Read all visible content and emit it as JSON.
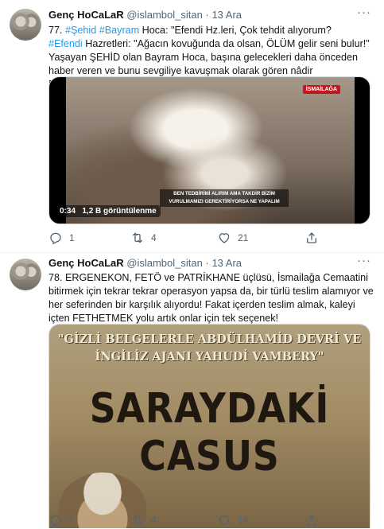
{
  "tweets": [
    {
      "author_name": "Genç HoCaLaR",
      "handle": "@islambol_sitan",
      "separator": "·",
      "date": "13 Ara",
      "more_label": "···",
      "text_line1_prefix": "77. ",
      "hashtag1": "#Şehid",
      "hashtag2": "#Bayram",
      "text_line1_suffix": " Hoca: \"Efendi Hz.leri, Çok tehdit alıyorum?",
      "hashtag3": "#Efendi",
      "text_line2_suffix": " Hazretleri: \"Ağacın kovuğunda da olsan, ÖLÜM gelir seni bulur!\"",
      "text_rest": "Yaşayan ŞEHİD olan Bayram Hoca, başına gelecekleri daha önceden haber veren ve bunu sevgiliye kavuşmak olarak gören nâdir ERLERDENDİ!",
      "video": {
        "logo_text": "İSMAİLAĞA",
        "subtitle": "BEN TEDBİRİMİ ALIRIM AMA TAKDİR BİZİM VURULMAMIZI GEREKTİRİYORSA NE YAPALIM",
        "duration": "0:34",
        "views": "1,2 B görüntülenme"
      },
      "replies": "1",
      "retweets": "4",
      "likes": "21"
    },
    {
      "author_name": "Genç HoCaLaR",
      "handle": "@islambol_sitan",
      "separator": "·",
      "date": "13 Ara",
      "more_label": "···",
      "text": "78. ERGENEKON, FETÖ ve PATRİKHANE üçlüsü, İsmailağa Cemaatini bitirmek için tekrar tekrar operasyon yapsa da, bir türlü teslim alamıyor ve her seferinden bir karşılık alıyordu! Fakat içerden teslim almak, kaleyi içten FETHETMEK yolu artık onlar için tek seçenek!",
      "poster": {
        "top_line1": "\"GİZLİ BELGELERLE ABDÜLHAMİD DEVRİ VE",
        "top_line2": "İNGİLİZ AJANI YAHUDİ VAMBERY\"",
        "title_line1": "SARAYDAKİ",
        "title_line2": "CASUS"
      },
      "replies": "1",
      "retweets": "4",
      "likes": "16"
    }
  ],
  "colors": {
    "link": "#1d9bf0",
    "muted": "#536471",
    "text": "#0f1419"
  },
  "icons": [
    "reply-icon",
    "retweet-icon",
    "like-icon",
    "share-icon",
    "more-icon"
  ]
}
